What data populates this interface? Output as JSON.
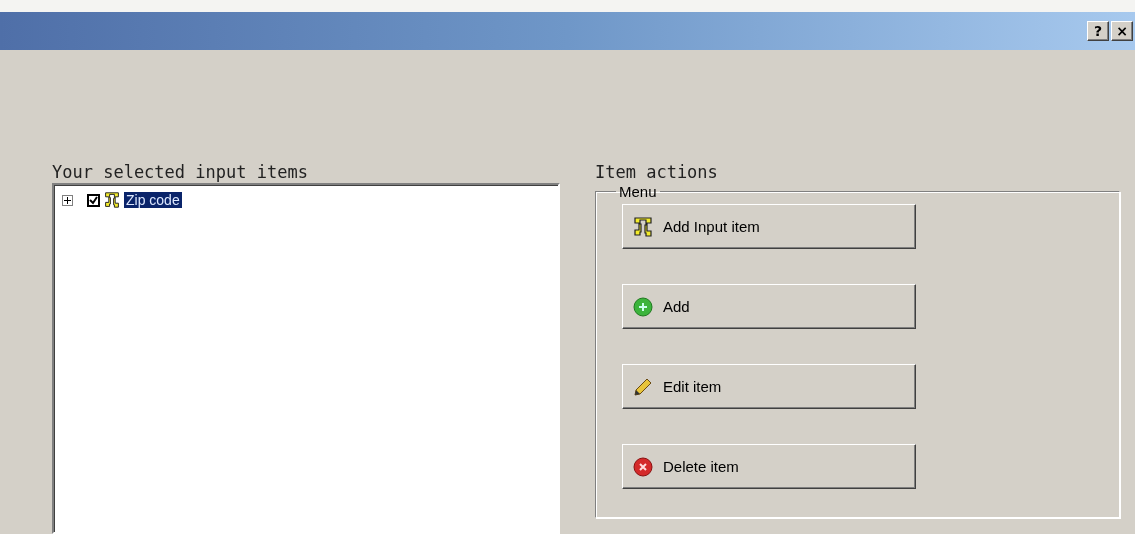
{
  "window": {
    "controls": [
      "?",
      "×"
    ]
  },
  "left_panel": {
    "title": "Your selected input items",
    "tree": [
      {
        "label": "Zip code",
        "expanded": false,
        "checked": true,
        "selected": true
      }
    ]
  },
  "right_panel": {
    "title": "Item actions",
    "group": {
      "legend": "Menu",
      "buttons": [
        {
          "label": "Add Input item",
          "kind": "input"
        },
        {
          "label": "Add",
          "kind": "add"
        },
        {
          "label": "Edit item",
          "kind": "edit"
        },
        {
          "label": "Delete item",
          "kind": "delete"
        }
      ]
    }
  }
}
